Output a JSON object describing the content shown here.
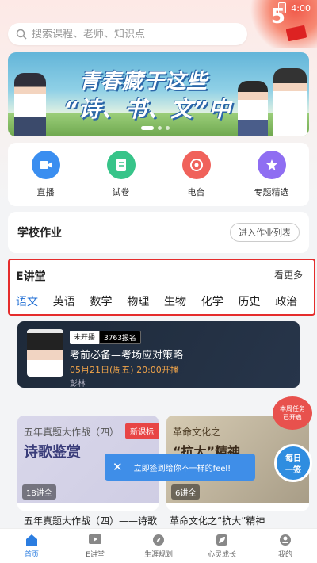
{
  "status": {
    "time": "4:00"
  },
  "search": {
    "placeholder": "搜索课程、老师、知识点"
  },
  "banner": {
    "line1": "青春藏于这些",
    "line2": "“诗、书、文”中"
  },
  "quick_menu": [
    {
      "label": "直播",
      "icon": "video-icon",
      "color": "#3a8ef0"
    },
    {
      "label": "试卷",
      "icon": "exam-paper-icon",
      "color": "#37c489"
    },
    {
      "label": "电台",
      "icon": "radio-icon",
      "color": "#f0625b"
    },
    {
      "label": "专题精选",
      "icon": "star-badge-icon",
      "color": "#8f6ef2"
    }
  ],
  "homework": {
    "title": "学校作业",
    "button": "进入作业列表"
  },
  "electure": {
    "title": "E讲堂",
    "more": "看更多",
    "tabs": [
      "语文",
      "英语",
      "数学",
      "物理",
      "生物",
      "化学",
      "历史",
      "政治"
    ],
    "active_tab": "语文"
  },
  "live_card": {
    "status": "未开播",
    "signups": "3763报名",
    "title": "考前必备—考场应对策略",
    "time": "05月21日(周五) 20:00开播",
    "teacher": "彭林"
  },
  "cards": [
    {
      "line1": "五年真题大作战（四）",
      "line2": "诗歌鉴赏",
      "tag": "新课标",
      "count": "18讲全",
      "title": "五年真题大作战（四）——诗歌"
    },
    {
      "line1": "革命文化之",
      "line2": "“抗大”精神",
      "count": "6讲全",
      "title": "革命文化之“抗大”精神"
    }
  ],
  "toast": {
    "text": "立即签到给你不一样的feel!"
  },
  "float_task": {
    "line1": "本周任务",
    "line2": "已开启"
  },
  "float_checkin": {
    "line1": "每日",
    "line2": "一签"
  },
  "bottom_nav": [
    {
      "label": "首页",
      "icon": "home-icon",
      "active": true
    },
    {
      "label": "E讲堂",
      "icon": "play-icon",
      "active": false
    },
    {
      "label": "生涯规划",
      "icon": "compass-icon",
      "active": false
    },
    {
      "label": "心灵成长",
      "icon": "leaf-icon",
      "active": false
    },
    {
      "label": "我的",
      "icon": "user-icon",
      "active": false
    }
  ]
}
